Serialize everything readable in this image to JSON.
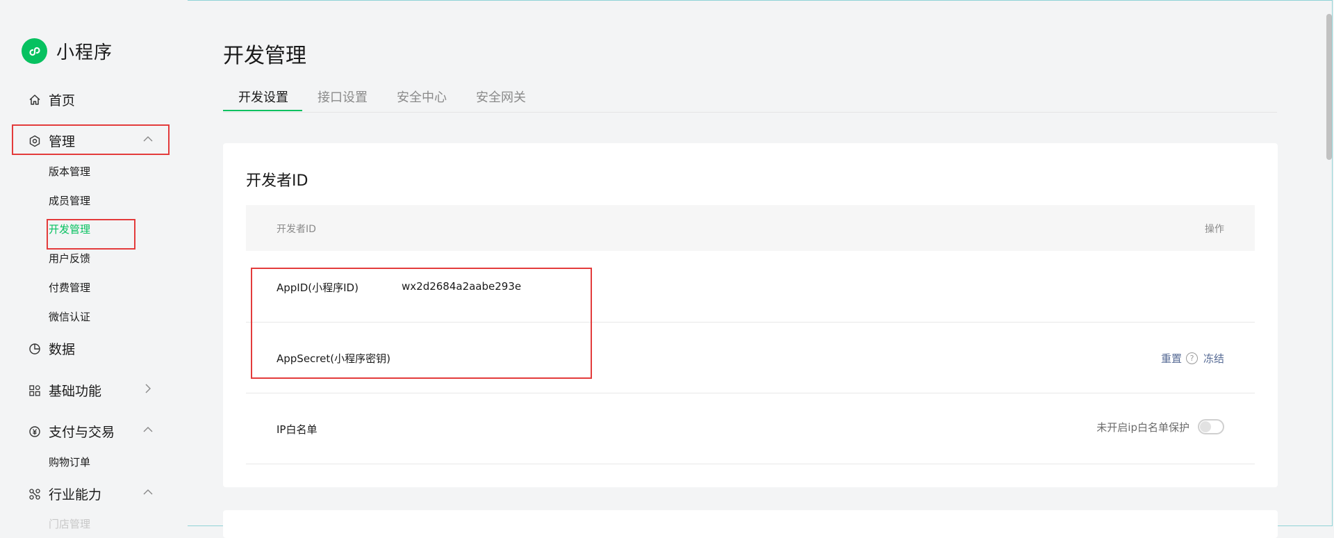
{
  "app": {
    "title": "小程序",
    "brand_color": "#07c160"
  },
  "sidebar": {
    "home": "首页",
    "manage": {
      "label": "管理",
      "items": [
        "版本管理",
        "成员管理",
        "开发管理",
        "用户反馈",
        "付费管理",
        "微信认证"
      ],
      "active": "开发管理"
    },
    "data": "数据",
    "basic": "基础功能",
    "pay": {
      "label": "支付与交易",
      "items": [
        "购物订单"
      ]
    },
    "industry": {
      "label": "行业能力",
      "items": [
        "门店管理"
      ]
    }
  },
  "page": {
    "title": "开发管理",
    "tabs": [
      "开发设置",
      "接口设置",
      "安全中心",
      "安全网关"
    ],
    "active_tab": "开发设置"
  },
  "developer_id": {
    "title": "开发者ID",
    "columns": {
      "name": "开发者ID",
      "action": "操作"
    },
    "rows": [
      {
        "label": "AppID(小程序ID)",
        "value": "wx2d2684a2aabe293e"
      },
      {
        "label": "AppSecret(小程序密钥)",
        "actions": [
          "重置",
          "冻结"
        ],
        "help_icon": "?"
      },
      {
        "label": "IP白名单",
        "status": "未开启ip白名单保护",
        "toggle_on": false
      }
    ]
  },
  "icons": [
    "mini-program-logo-icon",
    "home-icon",
    "settings-icon",
    "chevron-up-icon",
    "chart-icon",
    "grid-icon",
    "chevron-right-icon",
    "yuan-icon",
    "industry-icon",
    "help-icon"
  ],
  "colors": {
    "highlight": "#e33b3b",
    "link": "#576b95",
    "active": "#07c160"
  }
}
